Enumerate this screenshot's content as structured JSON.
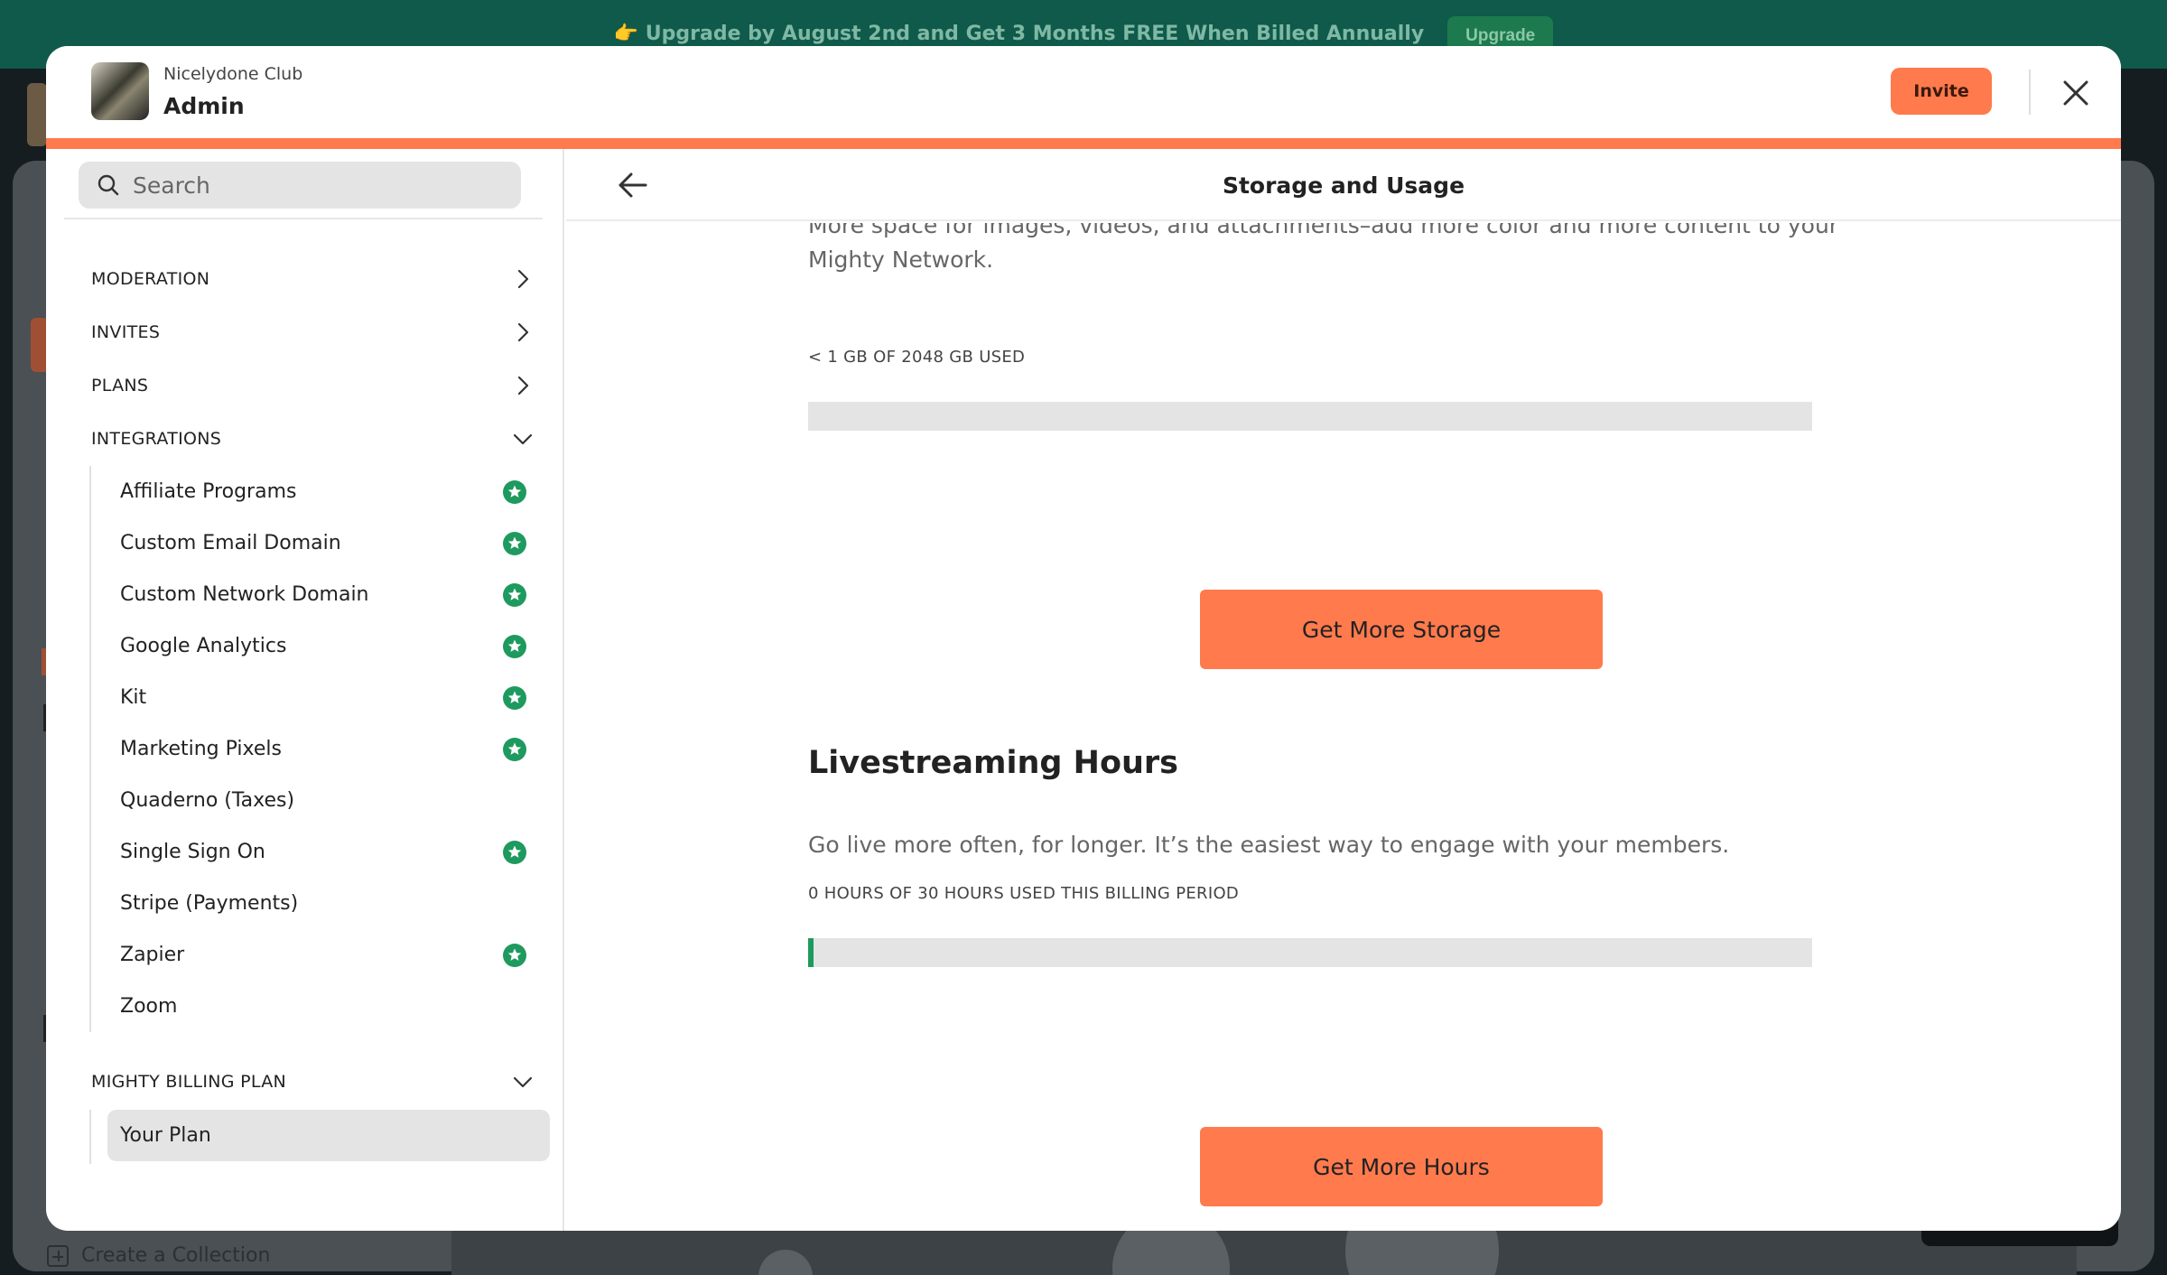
{
  "banner": {
    "text": "👉 Upgrade by August 2nd and Get 3 Months FREE When Billed Annually",
    "button": "Upgrade"
  },
  "background": {
    "create_collection": "Create a Collection"
  },
  "header": {
    "club_name": "Nicelydone Club",
    "title": "Admin",
    "invite_label": "Invite"
  },
  "sidebar": {
    "search_placeholder": "Search",
    "sections": [
      {
        "label": "MODERATION",
        "state": "collapsed"
      },
      {
        "label": "INVITES",
        "state": "collapsed"
      },
      {
        "label": "PLANS",
        "state": "collapsed"
      },
      {
        "label": "INTEGRATIONS",
        "state": "expanded"
      }
    ],
    "integrations": [
      {
        "label": "Affiliate Programs",
        "premium": true
      },
      {
        "label": "Custom Email Domain",
        "premium": true
      },
      {
        "label": "Custom Network Domain",
        "premium": true
      },
      {
        "label": "Google Analytics",
        "premium": true
      },
      {
        "label": "Kit",
        "premium": true
      },
      {
        "label": "Marketing Pixels",
        "premium": true
      },
      {
        "label": "Quaderno (Taxes)",
        "premium": false
      },
      {
        "label": "Single Sign On",
        "premium": true
      },
      {
        "label": "Stripe (Payments)",
        "premium": false
      },
      {
        "label": "Zapier",
        "premium": true
      },
      {
        "label": "Zoom",
        "premium": false
      }
    ],
    "billing_section": {
      "label": "MIGHTY BILLING PLAN",
      "state": "expanded"
    },
    "billing_items": [
      {
        "label": "Your Plan",
        "active": true
      }
    ]
  },
  "main": {
    "title": "Storage and Usage",
    "storage": {
      "description": "More space for images, videos, and attachments–add more color and more content to your Mighty Network.",
      "usage_text": "< 1 GB OF 2048 GB USED",
      "used_fraction": 0.0,
      "button": "Get More Storage"
    },
    "livestreaming": {
      "title": "Livestreaming Hours",
      "description": "Go live more often, for longer. It’s the easiest way to engage with your members.",
      "usage_text": "0 HOURS OF 30 HOURS USED THIS BILLING PERIOD",
      "used_fraction": 0.005,
      "button": "Get More Hours"
    }
  },
  "colors": {
    "accent": "#ff7a4d",
    "premium_badge": "#1e9a5e",
    "banner_bg": "#0f5a4a"
  },
  "icons": {
    "search": "search-icon",
    "chevron_right": "chevron-right-icon",
    "chevron_down": "chevron-down-icon",
    "premium": "star-badge-icon",
    "back": "arrow-left-icon",
    "close": "close-icon"
  }
}
